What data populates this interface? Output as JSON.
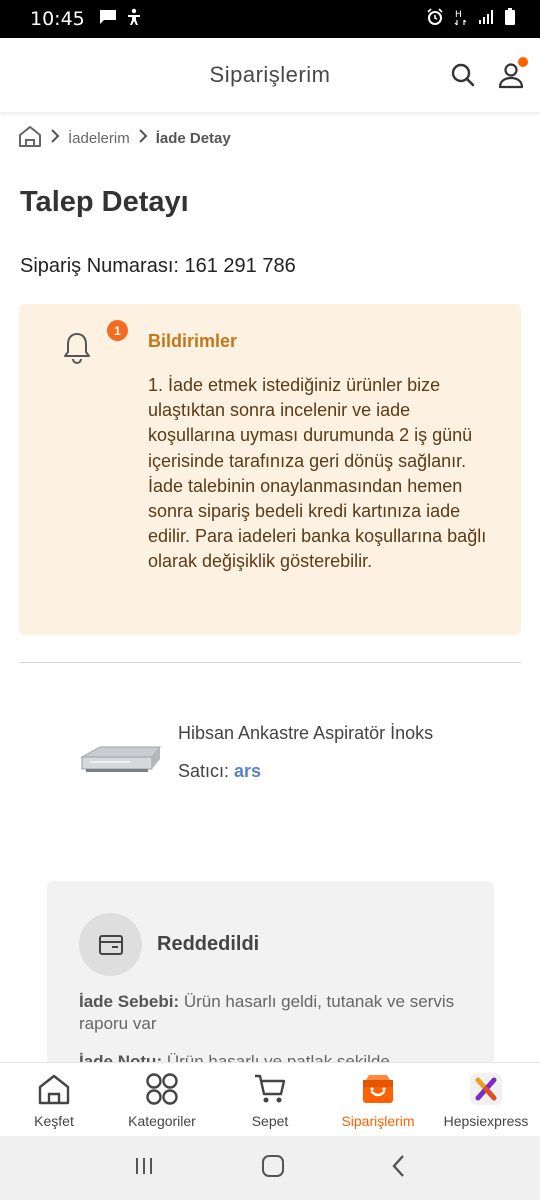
{
  "status_bar": {
    "time": "10:45",
    "left_icons": [
      "message-icon",
      "accessibility-icon"
    ],
    "right_icons": [
      "alarm-icon",
      "network-h-icon",
      "signal-icon",
      "battery-icon"
    ]
  },
  "header": {
    "title": "Siparişlerim",
    "search_icon": "search-icon",
    "user_icon": "user-icon",
    "user_dot_color": "#ff6000"
  },
  "breadcrumb": {
    "home_icon": "home-icon",
    "items": [
      "İadelerim",
      "İade Detay"
    ]
  },
  "page": {
    "title": "Talep Detayı",
    "order_number": "Sipariş Numarası: 161 291 786"
  },
  "notification": {
    "badge_count": "1",
    "title": "Bildirimler",
    "text": "1. İade etmek istediğiniz ürünler bize ulaştıktan sonra incelenir ve iade koşullarına uyması durumunda 2 iş günü içerisinde tarafınıza geri dönüş sağlanır. İade talebinin onaylanmasından hemen sonra sipariş bedeli kredi kartınıza iade edilir. Para iadeleri banka koşullarına bağlı olarak değişiklik gösterebilir.",
    "bg_color": "#fdf1e2",
    "title_color": "#c47619"
  },
  "product": {
    "name": "Hibsan Ankastre Aspiratör İnoks",
    "seller_label": "Satıcı: ",
    "seller_name": "ars",
    "seller_color": "#5b80cf"
  },
  "return_status": {
    "status": "Reddedildi",
    "reason_label": "İade Sebebi:",
    "reason_text": " Ürün hasarlı geldi, tutanak ve servis raporu var",
    "note_label": "İade Notu:",
    "note_text": " Ürün hasarlı ve patlak şekilde"
  },
  "bottom_nav": {
    "items": [
      {
        "label": "Keşfet",
        "icon": "home-icon"
      },
      {
        "label": "Kategoriler",
        "icon": "categories-icon"
      },
      {
        "label": "Sepet",
        "icon": "cart-icon"
      },
      {
        "label": "Siparişlerim",
        "icon": "orders-icon",
        "active": true
      },
      {
        "label": "Hepsiexpress",
        "icon": "hepsiexpress-icon"
      }
    ],
    "active_color": "#ff6000"
  },
  "system_nav": {
    "icons": [
      "recent-apps-icon",
      "home-button-icon",
      "back-icon"
    ]
  }
}
